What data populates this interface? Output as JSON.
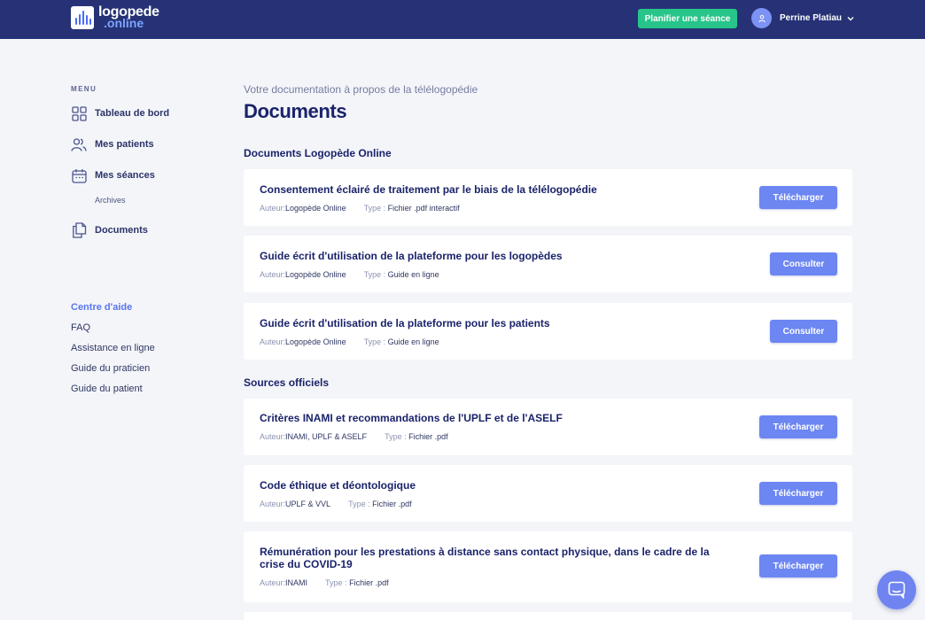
{
  "header": {
    "logo_line1": "logopede",
    "logo_line2": ".online",
    "plan_button": "Planifier une séance",
    "user_name": "Perrine Platiau"
  },
  "sidebar": {
    "menu_title": "MENU",
    "items": [
      {
        "label": "Tableau de bord",
        "icon": "dashboard-icon"
      },
      {
        "label": "Mes patients",
        "icon": "users-icon"
      },
      {
        "label": "Mes séances",
        "icon": "calendar-icon"
      },
      {
        "label": "Documents",
        "icon": "documents-icon"
      }
    ],
    "sub_item": "Archives",
    "help_title": "Centre d'aide",
    "help_links": [
      "FAQ",
      "Assistance en ligne",
      "Guide du praticien",
      "Guide du patient"
    ]
  },
  "main": {
    "subtitle": "Votre documentation à propos de la télélogopédie",
    "title": "Documents",
    "author_label": "Auteur:",
    "type_label": "Type :",
    "sections": [
      {
        "title": "Documents Logopède Online",
        "cards": [
          {
            "title": "Consentement éclairé de traitement par le biais de la télélogopédie",
            "author": "Logopède Online",
            "type": "Fichier .pdf interactif",
            "button": "Télécharger"
          },
          {
            "title": "Guide écrit d'utilisation de la plateforme pour les logopèdes",
            "author": "Logopède Online",
            "type": "Guide en ligne",
            "button": "Consulter"
          },
          {
            "title": "Guide écrit d'utilisation de la plateforme pour les patients",
            "author": "Logopède Online",
            "type": "Guide en ligne",
            "button": "Consulter"
          }
        ]
      },
      {
        "title": "Sources officiels",
        "cards": [
          {
            "title": "Critères INAMI et recommandations de l'UPLF et de l'ASELF",
            "author": "INAMI, UPLF & ASELF",
            "type": "Fichier .pdf",
            "button": "Télécharger"
          },
          {
            "title": "Code éthique et déontologique",
            "author": "UPLF & VVL",
            "type": "Fichier .pdf",
            "button": "Télécharger"
          },
          {
            "title": "Rémunération pour les prestations à distance sans contact physique, dans le cadre de la crise du COVID-19",
            "author": "INAMI",
            "type": "Fichier .pdf",
            "button": "Télécharger"
          }
        ]
      }
    ]
  },
  "colors": {
    "topbar": "#263275",
    "primary_button": "#6c86f2",
    "accent_green": "#27c58a",
    "help_title": "#5875ee"
  }
}
